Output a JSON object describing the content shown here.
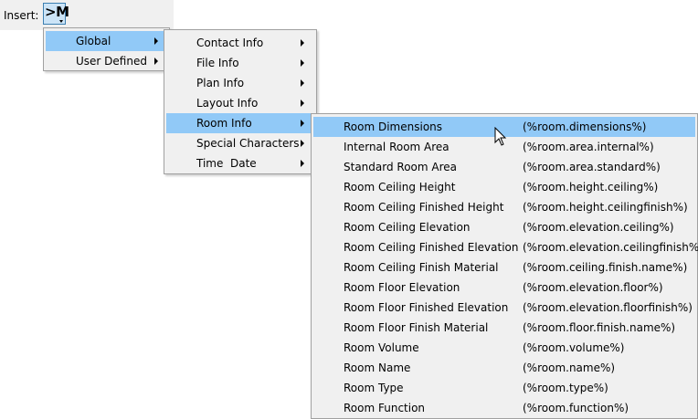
{
  "toolbar": {
    "insert_label": "Insert:",
    "macro_button_label": ">M",
    "macro_button_icon": "macro-insert-icon"
  },
  "menu_level1": {
    "items": [
      {
        "label": "Global",
        "selected": true,
        "has_submenu": true
      },
      {
        "label": "User Defined",
        "selected": false,
        "has_submenu": true
      }
    ]
  },
  "menu_level2": {
    "items": [
      {
        "label": "Contact Info",
        "has_submenu": true
      },
      {
        "label": "File Info",
        "has_submenu": true
      },
      {
        "label": "Plan Info",
        "has_submenu": true
      },
      {
        "label": "Layout Info",
        "has_submenu": true
      },
      {
        "label": "Room Info",
        "has_submenu": true,
        "selected": true
      },
      {
        "label": "Special Characters",
        "has_submenu": true
      },
      {
        "label": "Time  Date",
        "has_submenu": true
      }
    ]
  },
  "menu_level3": {
    "items": [
      {
        "label": "Room Dimensions",
        "macro": "(%room.dimensions%)",
        "selected": true
      },
      {
        "label": "Internal Room Area",
        "macro": "(%room.area.internal%)"
      },
      {
        "label": "Standard Room Area",
        "macro": "(%room.area.standard%)"
      },
      {
        "label": "Room Ceiling Height",
        "macro": "(%room.height.ceiling%)"
      },
      {
        "label": "Room Ceiling Finished Height",
        "macro": "(%room.height.ceilingfinish%)"
      },
      {
        "label": "Room Ceiling Elevation",
        "macro": "(%room.elevation.ceiling%)"
      },
      {
        "label": "Room Ceiling Finished Elevation",
        "macro": "(%room.elevation.ceilingfinish%)"
      },
      {
        "label": "Room Ceiling Finish Material",
        "macro": "(%room.ceiling.finish.name%)"
      },
      {
        "label": "Room Floor Elevation",
        "macro": "(%room.elevation.floor%)"
      },
      {
        "label": "Room Floor Finished Elevation",
        "macro": "(%room.elevation.floorfinish%)"
      },
      {
        "label": "Room Floor Finish Material",
        "macro": "(%room.floor.finish.name%)"
      },
      {
        "label": "Room Volume",
        "macro": "(%room.volume%)"
      },
      {
        "label": "Room Name",
        "macro": "(%room.name%)"
      },
      {
        "label": "Room Type",
        "macro": "(%room.type%)"
      },
      {
        "label": "Room Function",
        "macro": "(%room.function%)"
      }
    ]
  },
  "colors": {
    "menu_background": "#f0f0f0",
    "selection": "#91c9f7",
    "button_highlight": "#cce4f7"
  }
}
